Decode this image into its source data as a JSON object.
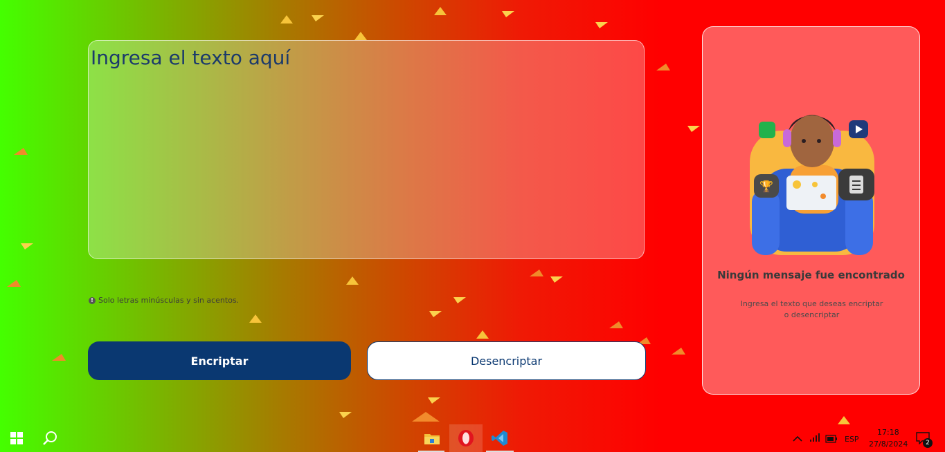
{
  "main": {
    "textarea_placeholder": "Ingresa el texto aquí",
    "hint": "Solo letras minúsculas y sin acentos.",
    "encrypt_label": "Encriptar",
    "decrypt_label": "Desencriptar"
  },
  "output": {
    "empty_title": "Ningún mensaje fue encontrado",
    "empty_desc_line1": "Ingresa el texto que deseas encriptar",
    "empty_desc_line2": "o desencriptar"
  },
  "taskbar": {
    "language": "ESP",
    "time": "17:18",
    "date": "27/8/2024",
    "notification_count": "2",
    "pinned_apps": [
      "file-explorer-icon",
      "opera-icon",
      "vscode-icon"
    ]
  },
  "colors": {
    "accent": "#0a3871",
    "panel": "#ff5a5a"
  }
}
